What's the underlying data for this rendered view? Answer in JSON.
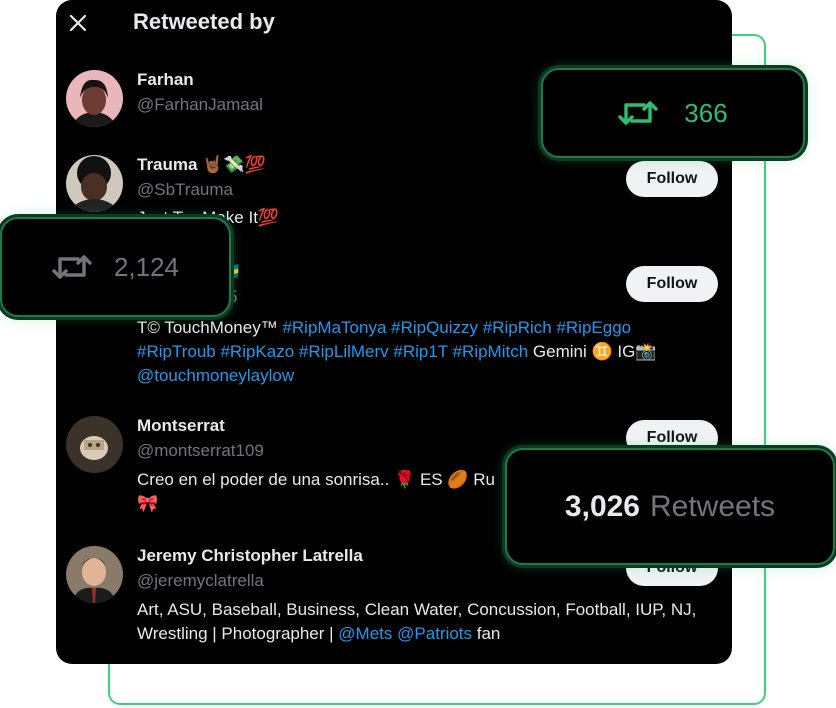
{
  "panel": {
    "title": "Retweeted by",
    "follow_label": "Follow"
  },
  "users": [
    {
      "name": "Farhan",
      "handle": "@FarhanJamaal",
      "bio": ""
    },
    {
      "name": "Trauma 🤘🏾💸💯",
      "handle": "@SbTrauma",
      "bio": "Just Tr_ Make It💯"
    },
    {
      "name_suffix": "🇧🇸",
      "handle_suffix": "5",
      "bio": {
        "plain_1": "T© TouchMoney™ ",
        "tags_1": "#RipMaTonya #RipQuizzy #RipRich #RipEggo #RipTroub #RipKazo #RipLilMerv #Rip1T #RipMitch",
        "plain_2": " Gemini ♊ IG📸 ",
        "mention": "@touchmoneylaylow"
      }
    },
    {
      "name": "Montserrat",
      "handle": "@montserrat109",
      "bio_line1": "Creo en el poder de una sonrisa.. 🌹 ES 🏉 Ru",
      "bio_line2": "🎀"
    },
    {
      "name": "Jeremy Christopher Latrella",
      "handle": "@jeremyclatrella",
      "bio": {
        "plain": "Art, ASU, Baseball, Business, Clean Water, Concussion, Football, IUP, NJ, Wrestling | Photographer | ",
        "mention_1": "@Mets",
        "mention_2": "@Patriots",
        "plain_end": " fan"
      }
    }
  ],
  "stats": {
    "retweet_count_highlight": "366",
    "retweet_count_muted": "2,124",
    "total_count": "3,026",
    "total_label": "Retweets"
  },
  "colors": {
    "accent_green": "#2fbd74",
    "link_blue": "#1d9bf0",
    "muted_gray": "#71767b",
    "panel_bg": "#000000"
  },
  "icons": [
    "close-icon",
    "retweet-icon"
  ]
}
